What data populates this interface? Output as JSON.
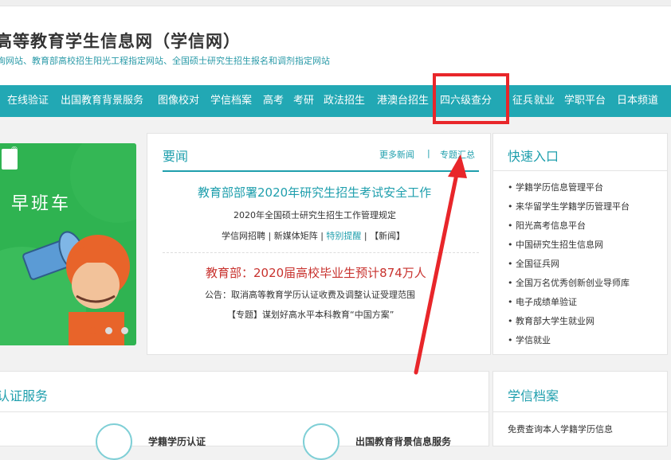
{
  "header": {
    "title": "高等教育学生信息网（学信网）",
    "subtitle": "询网站、教育部高校招生阳光工程指定网站、全国硕士研究生招生报名和调剂指定网站"
  },
  "nav": {
    "items": [
      "在线验证",
      "出国教育背景服务",
      "图像校对",
      "学信档案",
      "高考",
      "考研",
      "政法招生",
      "港澳台招生",
      "四六级查分",
      "征兵",
      "就业",
      "学职平台",
      "日本频道"
    ]
  },
  "banner": {
    "reg_mark": "®",
    "text": "早班车"
  },
  "news": {
    "title": "要闻",
    "more_link": "更多新闻",
    "separator": "|",
    "topics_link": "专题汇总",
    "headline1": "教育部部署2020年研究生招生考试安全工作",
    "sub1": "2020年全国硕士研究生招生工作管理规定",
    "links": [
      "学信网招聘",
      "新媒体矩阵",
      "特别提醒",
      "【新闻】"
    ],
    "headline2": "教育部：2020届高校毕业生预计874万人",
    "sub2": "公告：取消高等教育学历认证收费及调整认证受理范围",
    "sub3": "【专题】谋划好高水平本科教育“中国方案”"
  },
  "quick": {
    "title": "快速入口",
    "items": [
      "学籍学历信息管理平台",
      "来华留学生学籍学历管理平台",
      "阳光高考信息平台",
      "中国研究生招生信息网",
      "全国征兵网",
      "全国万名优秀创新创业导师库",
      "电子成绩单验证",
      "教育部大学生就业网",
      "学信就业"
    ]
  },
  "cert": {
    "title": "认证服务",
    "service1": "学籍学历认证",
    "service2": "出国教育背景信息服务"
  },
  "archive": {
    "title": "学信档案",
    "text": "免费查询本人学籍学历信息"
  },
  "colors": {
    "teal": "#22a8b4",
    "red_highlight": "#e8262a",
    "banner_green": "#2fb351"
  }
}
